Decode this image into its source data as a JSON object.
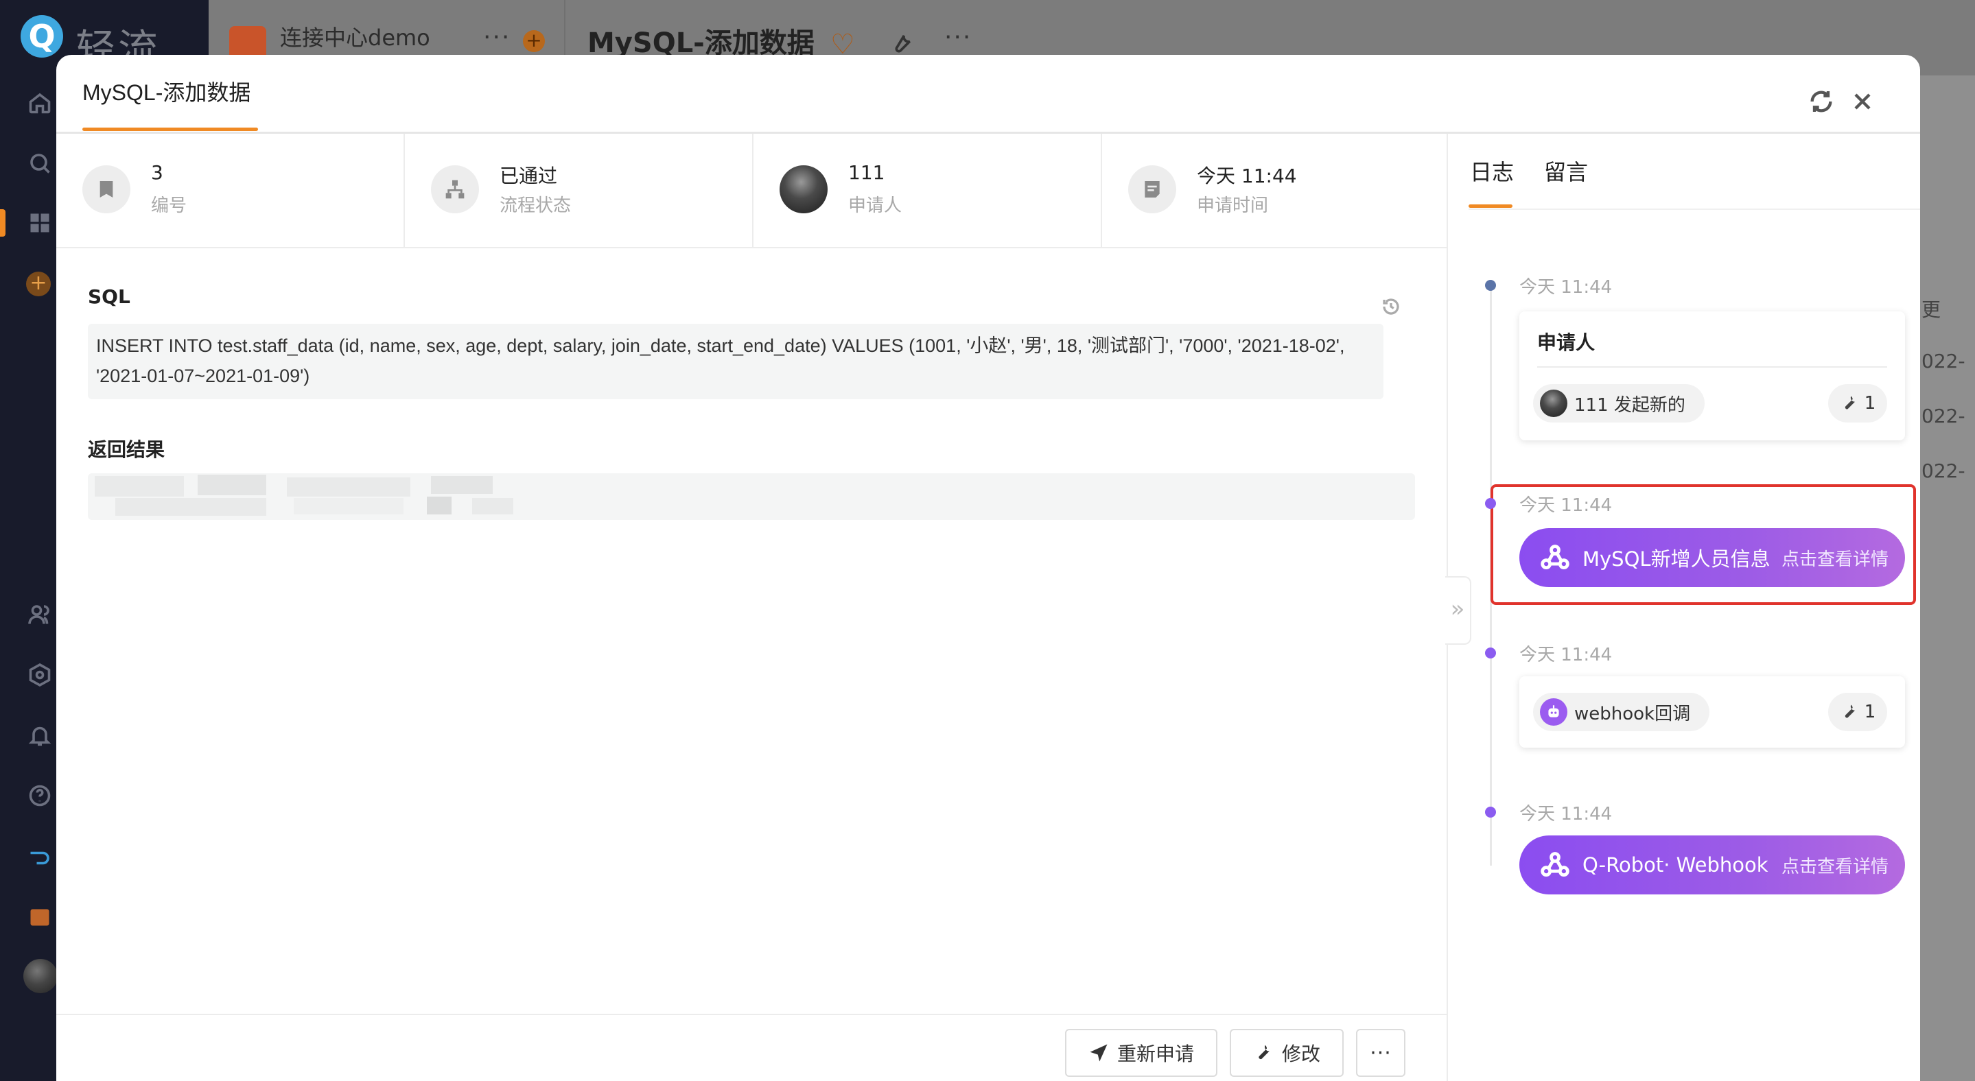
{
  "app": {
    "brand_letter": "Q",
    "brand_name": "轻流",
    "workspace_tab": "连接中心demo",
    "page_title": "MySQL-添加数据",
    "dots": "···"
  },
  "modal": {
    "title": "MySQL-添加数据",
    "info": [
      {
        "value": "3",
        "label": "编号"
      },
      {
        "value": "已通过",
        "label": "流程状态"
      },
      {
        "value": "111",
        "label": "申请人"
      },
      {
        "value": "今天 11:44",
        "label": "申请时间"
      }
    ],
    "sql_label": "SQL",
    "sql_text": "INSERT INTO test.staff_data (id, name, sex, age, dept, salary, join_date, start_end_date) VALUES (1001, '小赵', '男', 18, '测试部门', '7000', '2021-18-02', '2021-01-07~2021-01-09')",
    "result_label": "返回结果",
    "footer": {
      "reapply": "重新申请",
      "edit": "修改",
      "more": "···"
    }
  },
  "panel": {
    "tabs": [
      "日志",
      "留言"
    ],
    "collapse": "»",
    "timeline": [
      {
        "time": "今天 11:44",
        "card_title": "申请人",
        "chip_text": "111 发起新的",
        "count": "1",
        "dot_color": "#5b74a8"
      },
      {
        "time": "今天 11:44",
        "pill_name": "MySQL新增人员信息",
        "pill_link": "点击查看详情",
        "dot_color": "#8b5cf0"
      },
      {
        "time": "今天 11:44",
        "chip_text": "webhook回调",
        "count": "1",
        "dot_color": "#8b5cf0"
      },
      {
        "time": "今天 11:44",
        "pill_name": "Q-Robot· Webhook",
        "pill_link": "点击查看详情",
        "dot_color": "#8b5cf0"
      }
    ]
  },
  "background_right_col": [
    "更",
    "022-",
    "022-",
    "022-"
  ]
}
